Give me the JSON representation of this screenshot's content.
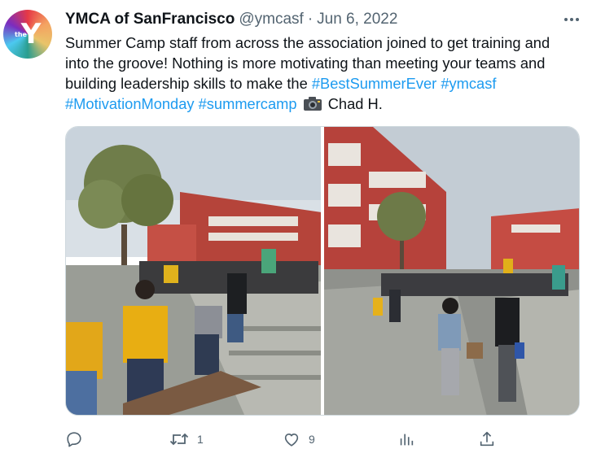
{
  "tweet": {
    "display_name": "YMCA of SanFrancisco",
    "handle": "@ymcasf",
    "separator": "·",
    "date": "Jun 6, 2022",
    "avatar_small_text": "the",
    "avatar_letter": "Y",
    "text_lines": {
      "line1": "Summer Camp staff from across the association joined to get training and",
      "line2": "into the groove! Nothing is more motivating than meeting your teams and",
      "line3_plain": "building leadership skills to make the ",
      "line3_tag1": "#BestSummerEver",
      "line3_tag2": "#ymcasf",
      "line4_tag1": "#MotivationMonday",
      "line4_tag2": "#summercamp",
      "line4_credit": "Chad H."
    },
    "media": [
      {
        "description_icon": "photo-campus-courtyard-left"
      },
      {
        "description_icon": "photo-campus-courtyard-right"
      }
    ],
    "actions": {
      "reply_count": "",
      "retweet_count": "1",
      "like_count": "9",
      "views_count": "",
      "share_count": ""
    }
  },
  "colors": {
    "link": "#1d9bf0",
    "secondary_text": "#536471",
    "primary_text": "#0f1419",
    "border": "#cfd9de"
  },
  "icons": [
    "more-icon",
    "camera-icon",
    "reply-icon",
    "retweet-icon",
    "like-icon",
    "views-icon",
    "share-icon"
  ]
}
